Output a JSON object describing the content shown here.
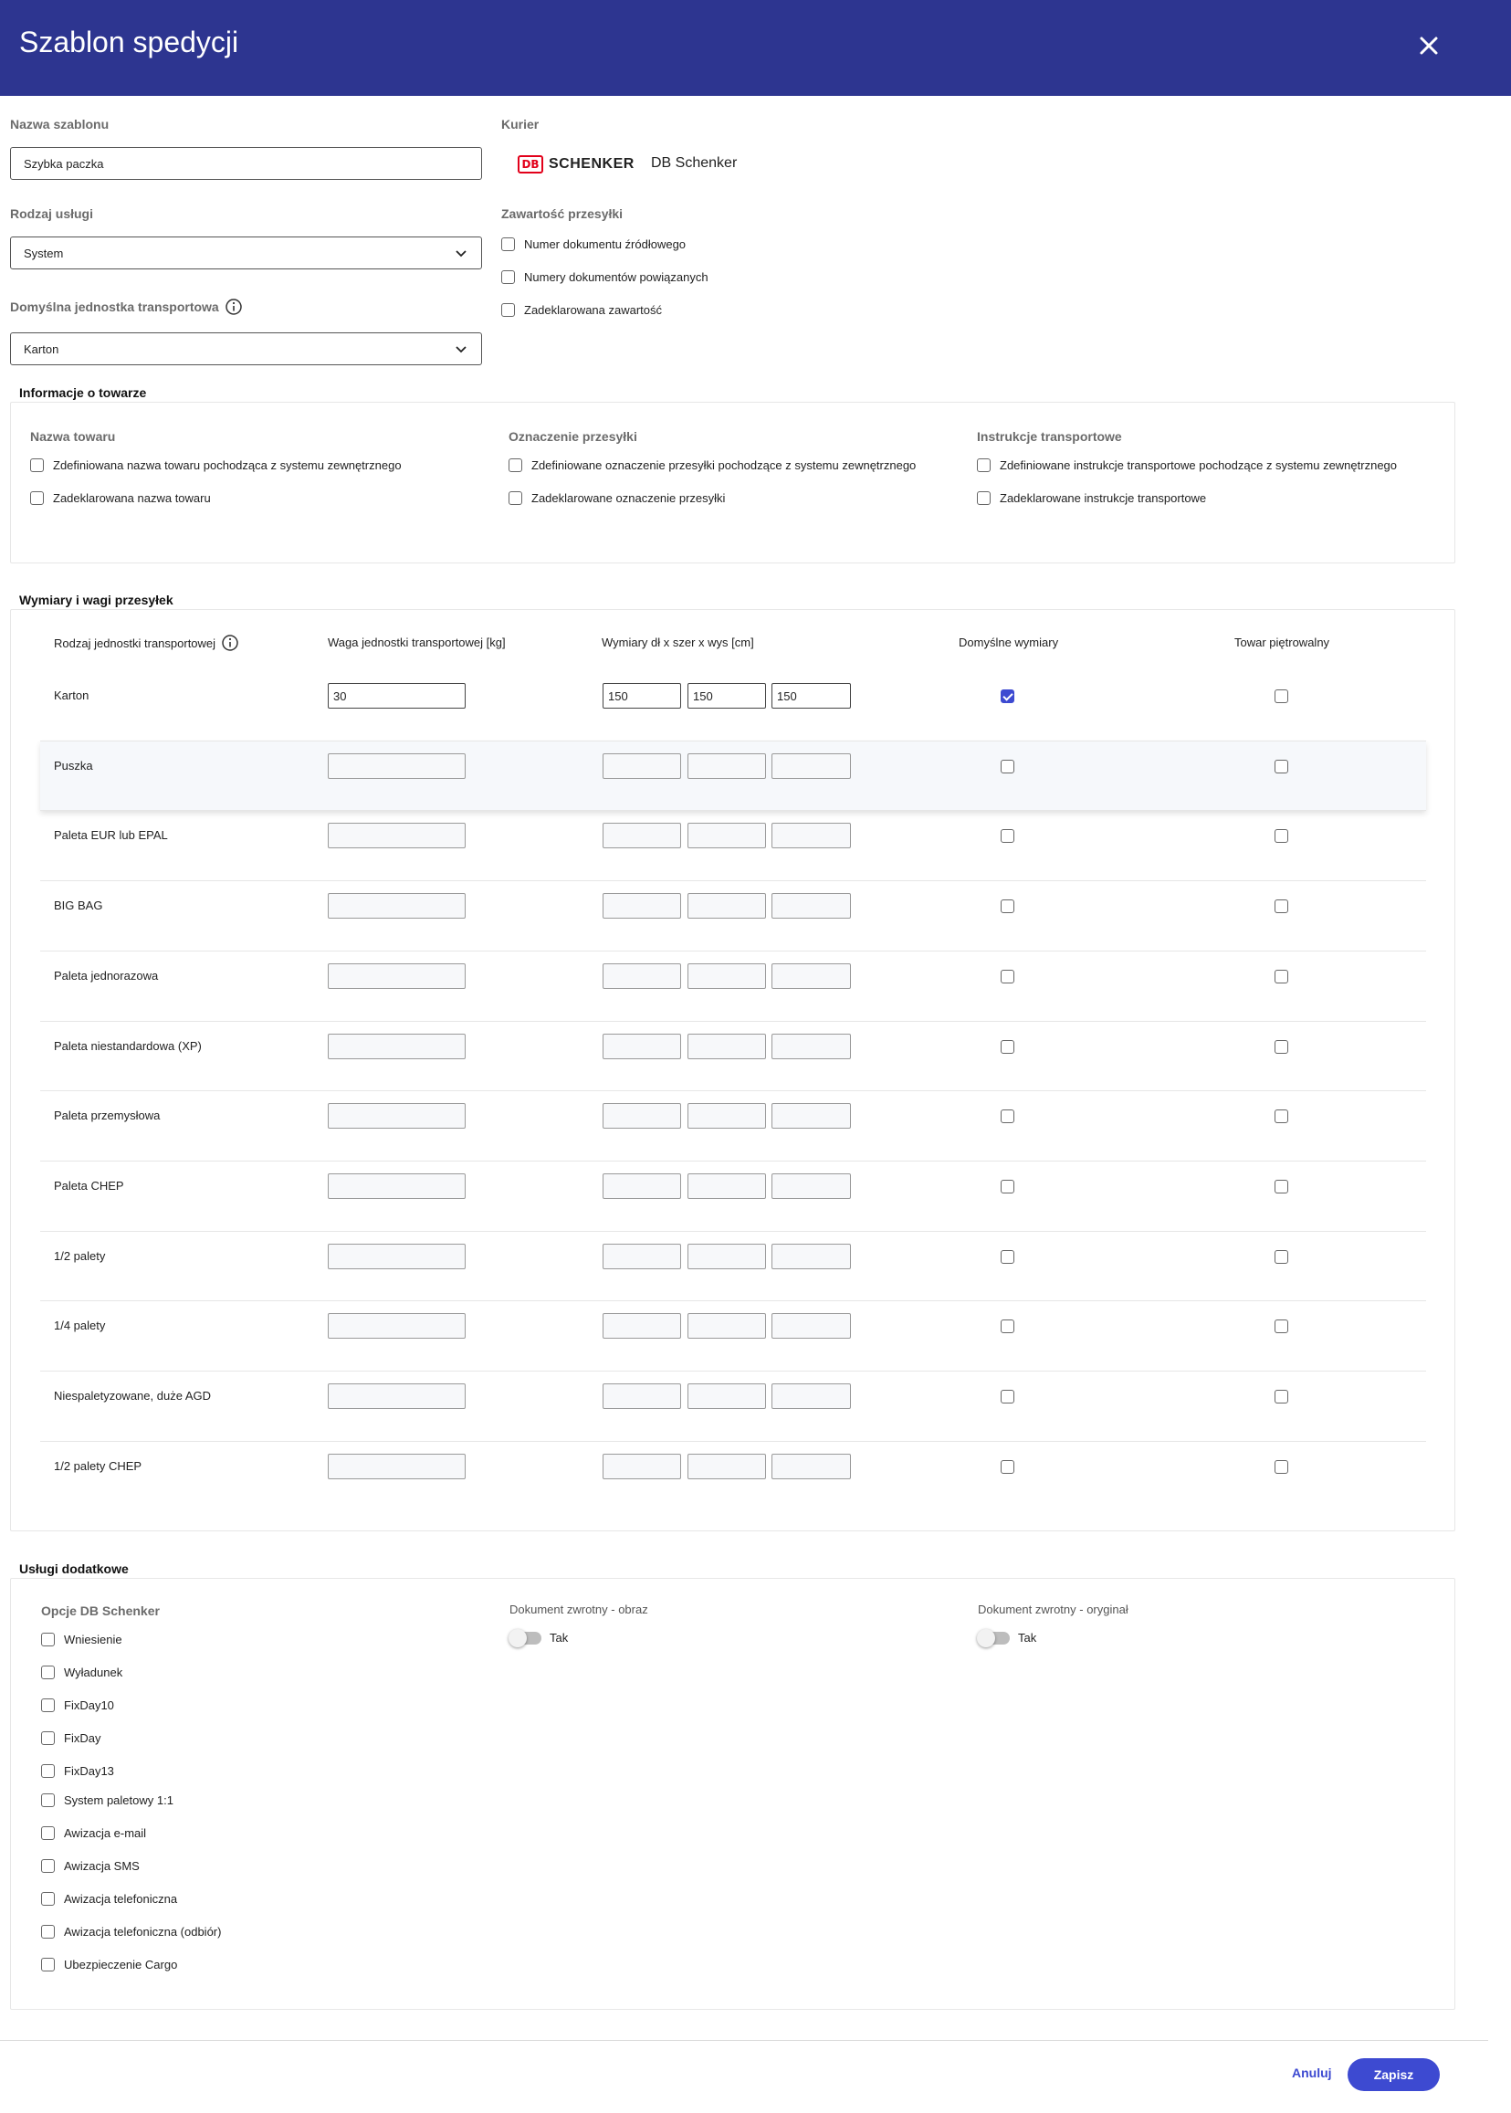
{
  "header": {
    "title": "Szablon spedycji"
  },
  "form": {
    "template_name_label": "Nazwa szablonu",
    "template_name_value": "Szybka paczka",
    "service_type_label": "Rodzaj usługi",
    "service_type_value": "System",
    "default_unit_label": "Domyślna jednostka transportowa",
    "default_unit_value": "Karton",
    "courier_label": "Kurier",
    "courier_logo_db": "DB",
    "courier_logo_text": "SCHENKER",
    "courier_name": "DB Schenker",
    "contents_label": "Zawartość przesyłki",
    "contents_options": [
      "Numer dokumentu źródłowego",
      "Numery dokumentów powiązanych",
      "Zadeklarowana zawartość"
    ]
  },
  "goods": {
    "title": "Informacje o towarze",
    "col1_label": "Nazwa towaru",
    "col1_options": [
      "Zdefiniowana nazwa towaru pochodząca z systemu zewnętrznego",
      "Zadeklarowana nazwa towaru"
    ],
    "col2_label": "Oznaczenie przesyłki",
    "col2_options": [
      "Zdefiniowane oznaczenie przesyłki pochodzące z systemu zewnętrznego",
      "Zadeklarowane oznaczenie przesyłki"
    ],
    "col3_label": "Instrukcje transportowe",
    "col3_options": [
      "Zdefiniowane instrukcje transportowe pochodzące z systemu zewnętrznego",
      "Zadeklarowane instrukcje transportowe"
    ]
  },
  "dimensions": {
    "title": "Wymiary i wagi przesyłek",
    "headers": {
      "unit_type": "Rodzaj jednostki transportowej",
      "weight": "Waga jednostki transportowej [kg]",
      "dims": "Wymiary dł x szer x wys [cm]",
      "default_dims": "Domyślne wymiary",
      "stackable": "Towar piętrowalny"
    },
    "rows": [
      {
        "label": "Karton",
        "weight": "30",
        "length": "150",
        "width": "150",
        "height": "150",
        "default": true,
        "stackable": false
      },
      {
        "label": "Puszka",
        "weight": "",
        "length": "",
        "width": "",
        "height": "",
        "default": false,
        "stackable": false
      },
      {
        "label": "Paleta EUR lub EPAL",
        "weight": "",
        "length": "",
        "width": "",
        "height": "",
        "default": false,
        "stackable": false
      },
      {
        "label": "BIG BAG",
        "weight": "",
        "length": "",
        "width": "",
        "height": "",
        "default": false,
        "stackable": false
      },
      {
        "label": "Paleta jednorazowa",
        "weight": "",
        "length": "",
        "width": "",
        "height": "",
        "default": false,
        "stackable": false
      },
      {
        "label": "Paleta niestandardowa (XP)",
        "weight": "",
        "length": "",
        "width": "",
        "height": "",
        "default": false,
        "stackable": false
      },
      {
        "label": "Paleta przemysłowa",
        "weight": "",
        "length": "",
        "width": "",
        "height": "",
        "default": false,
        "stackable": false
      },
      {
        "label": "Paleta CHEP",
        "weight": "",
        "length": "",
        "width": "",
        "height": "",
        "default": false,
        "stackable": false
      },
      {
        "label": "1/2 palety",
        "weight": "",
        "length": "",
        "width": "",
        "height": "",
        "default": false,
        "stackable": false
      },
      {
        "label": "1/4 palety",
        "weight": "",
        "length": "",
        "width": "",
        "height": "",
        "default": false,
        "stackable": false
      },
      {
        "label": "Niespaletyzowane, duże AGD",
        "weight": "",
        "length": "",
        "width": "",
        "height": "",
        "default": false,
        "stackable": false
      },
      {
        "label": "1/2 palety CHEP",
        "weight": "",
        "length": "",
        "width": "",
        "height": "",
        "default": false,
        "stackable": false
      }
    ]
  },
  "extras": {
    "title": "Usługi dodatkowe",
    "options_label": "Opcje DB Schenker",
    "options": [
      "Wniesienie",
      "Wyładunek",
      "FixDay10",
      "FixDay",
      "FixDay13",
      "System paletowy 1:1",
      "Awizacja e-mail",
      "Awizacja SMS",
      "Awizacja telefoniczna",
      "Awizacja telefoniczna (odbiór)",
      "Ubezpieczenie Cargo"
    ],
    "return_doc_image_label": "Dokument zwrotny - obraz",
    "return_doc_image_toggle": "Tak",
    "return_doc_original_label": "Dokument zwrotny - oryginał",
    "return_doc_original_toggle": "Tak"
  },
  "footer": {
    "cancel_label": "Anuluj",
    "save_label": "Zapisz"
  },
  "colors": {
    "header_bg": "#2d3590",
    "accent": "#3d4ad1",
    "db_red": "#e2001a"
  },
  "icons": [
    "close-icon",
    "chevron-down-icon",
    "info-icon",
    "checkbox-icon",
    "toggle-icon"
  ]
}
